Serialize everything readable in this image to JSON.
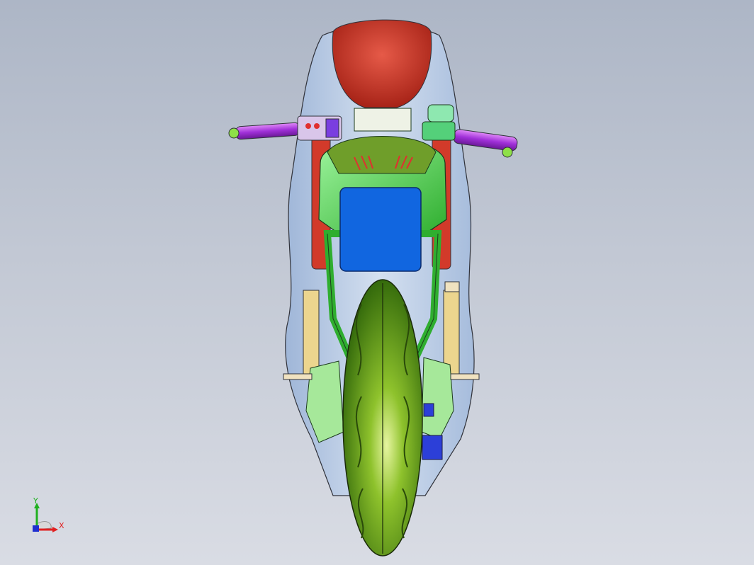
{
  "viewport": {
    "view": "Front",
    "background_top": "#adb6c6",
    "background_bottom": "#d9dce4"
  },
  "triad": {
    "x_label": "X",
    "y_label": "Y",
    "x_color": "#e02020",
    "y_color": "#20b020",
    "z_color": "#2030d0"
  },
  "model": {
    "fairing_color": "#b9cbe6",
    "headlight_color": "#d23a2a",
    "frame_color": "#3fd63f",
    "tire_color": "#5aa11a",
    "grip_color": "#b040e0",
    "number_plate_color": "#1166e0",
    "caliper_color": "#2c3fd8",
    "fork_color": "#ecd58e"
  }
}
